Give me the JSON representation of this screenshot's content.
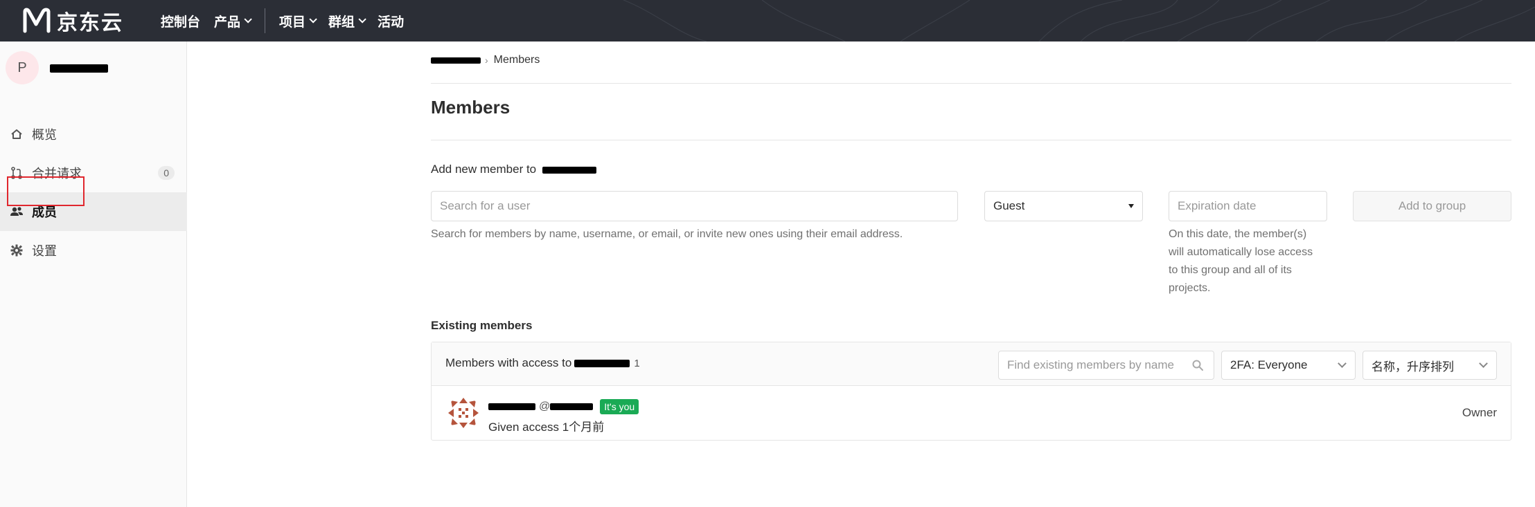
{
  "topbar": {
    "logo_text": "京东云",
    "nav": [
      {
        "label": "控制台",
        "has_caret": false
      },
      {
        "label": "产品",
        "has_caret": true
      },
      {
        "label": "项目",
        "has_caret": true
      },
      {
        "label": "群组",
        "has_caret": true
      },
      {
        "label": "活动",
        "has_caret": false
      }
    ]
  },
  "sidebar": {
    "group_avatar_letter": "P",
    "items": [
      {
        "label": "概览",
        "icon": "home-icon"
      },
      {
        "label": "合并请求",
        "icon": "merge-request-icon",
        "count": "0"
      },
      {
        "label": "成员",
        "icon": "users-icon",
        "active": true
      },
      {
        "label": "设置",
        "icon": "gear-icon"
      }
    ]
  },
  "breadcrumb": {
    "current": "Members"
  },
  "page": {
    "title": "Members"
  },
  "add_member": {
    "label": "Add new member to",
    "search_placeholder": "Search for a user",
    "search_help": "Search for members by name, username, or email, or invite new ones using their email address.",
    "role_selected": "Guest",
    "expiration_placeholder": "Expiration date",
    "expiration_help": [
      "On this date, the member(s)",
      "will automatically lose access",
      "to this group and all of its",
      "projects."
    ],
    "add_button": "Add to group"
  },
  "existing": {
    "title": "Existing members",
    "header_text": "Members with access to",
    "count": "1",
    "find_placeholder": "Find existing members by name",
    "twofa_selected": "2FA: Everyone",
    "sort_selected": "名称，升序排列",
    "members": [
      {
        "at": "@",
        "badge": "It's you",
        "access": "Given access 1个月前",
        "role": "Owner"
      }
    ]
  },
  "colors": {
    "topbar": "#2b2e36",
    "badge_green": "#1aaa55",
    "active_outline": "#e0262d"
  }
}
